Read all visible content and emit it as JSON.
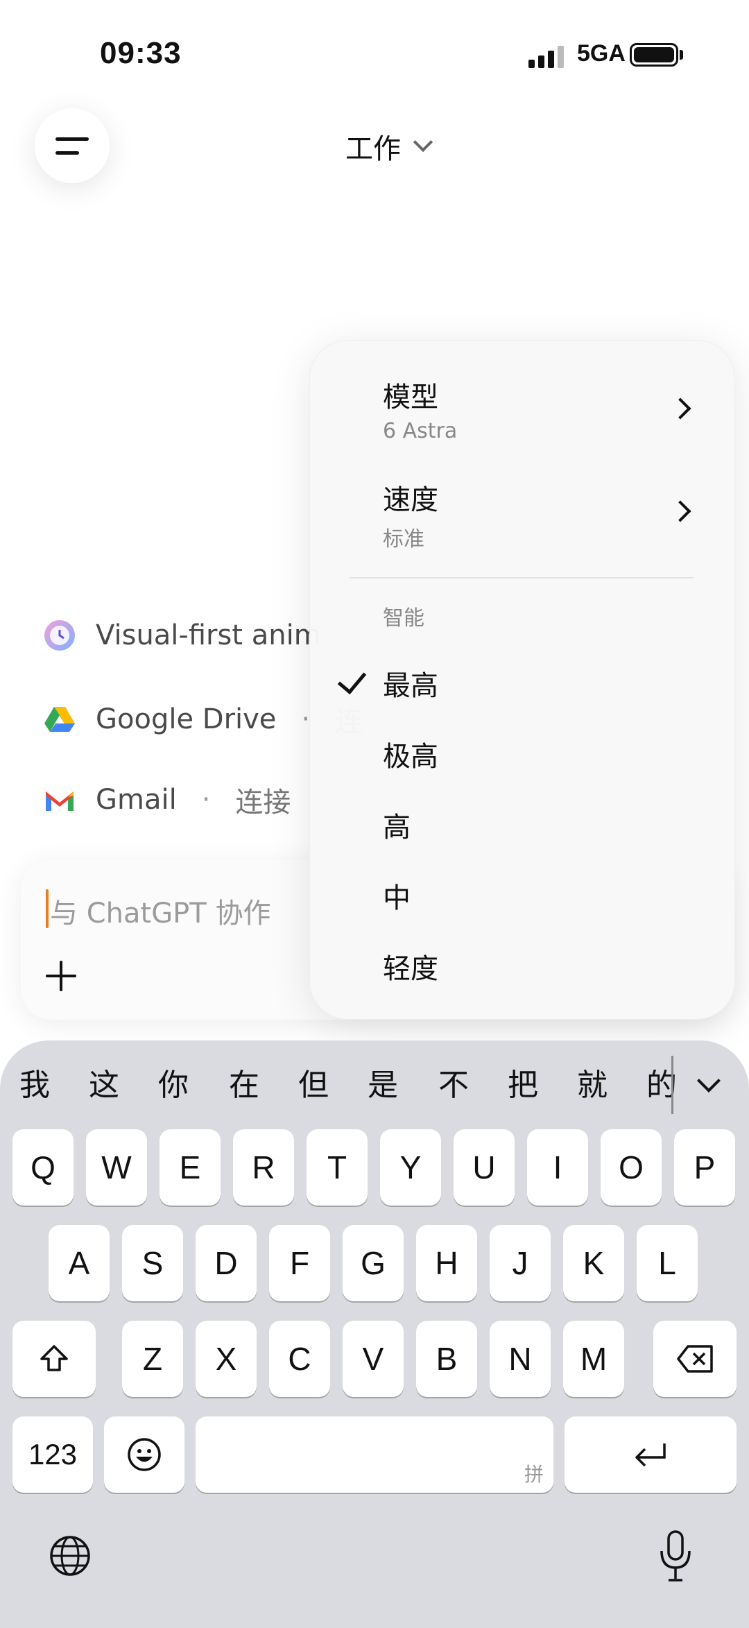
{
  "status": {
    "time": "09:33",
    "network": "5GA"
  },
  "header": {
    "title": "工作"
  },
  "suggestions": [
    {
      "label": "Visual-first anim",
      "sub": "",
      "icon": "clock-app-icon"
    },
    {
      "label": "Google Drive",
      "sub": "连",
      "icon": "google-drive-icon"
    },
    {
      "label": "Gmail",
      "sub": "连接",
      "icon": "gmail-icon"
    }
  ],
  "composer": {
    "placeholder": "与 ChatGPT 协作"
  },
  "menu": {
    "model_label": "模型",
    "model_value": "6 Astra",
    "speed_label": "速度",
    "speed_value": "标准",
    "intelligence_header": "智能",
    "intelligence_options": [
      "最高",
      "极高",
      "高",
      "中",
      "轻度"
    ],
    "intelligence_selected": "最高"
  },
  "keyboard": {
    "candidates": [
      "我",
      "这",
      "你",
      "在",
      "但",
      "是",
      "不",
      "把",
      "就",
      "的"
    ],
    "row1": [
      "Q",
      "W",
      "E",
      "R",
      "T",
      "Y",
      "U",
      "I",
      "O",
      "P"
    ],
    "row2": [
      "A",
      "S",
      "D",
      "F",
      "G",
      "H",
      "J",
      "K",
      "L"
    ],
    "row3": [
      "Z",
      "X",
      "C",
      "V",
      "B",
      "N",
      "M"
    ],
    "numbers_key": "123",
    "space_hint": "拼"
  }
}
